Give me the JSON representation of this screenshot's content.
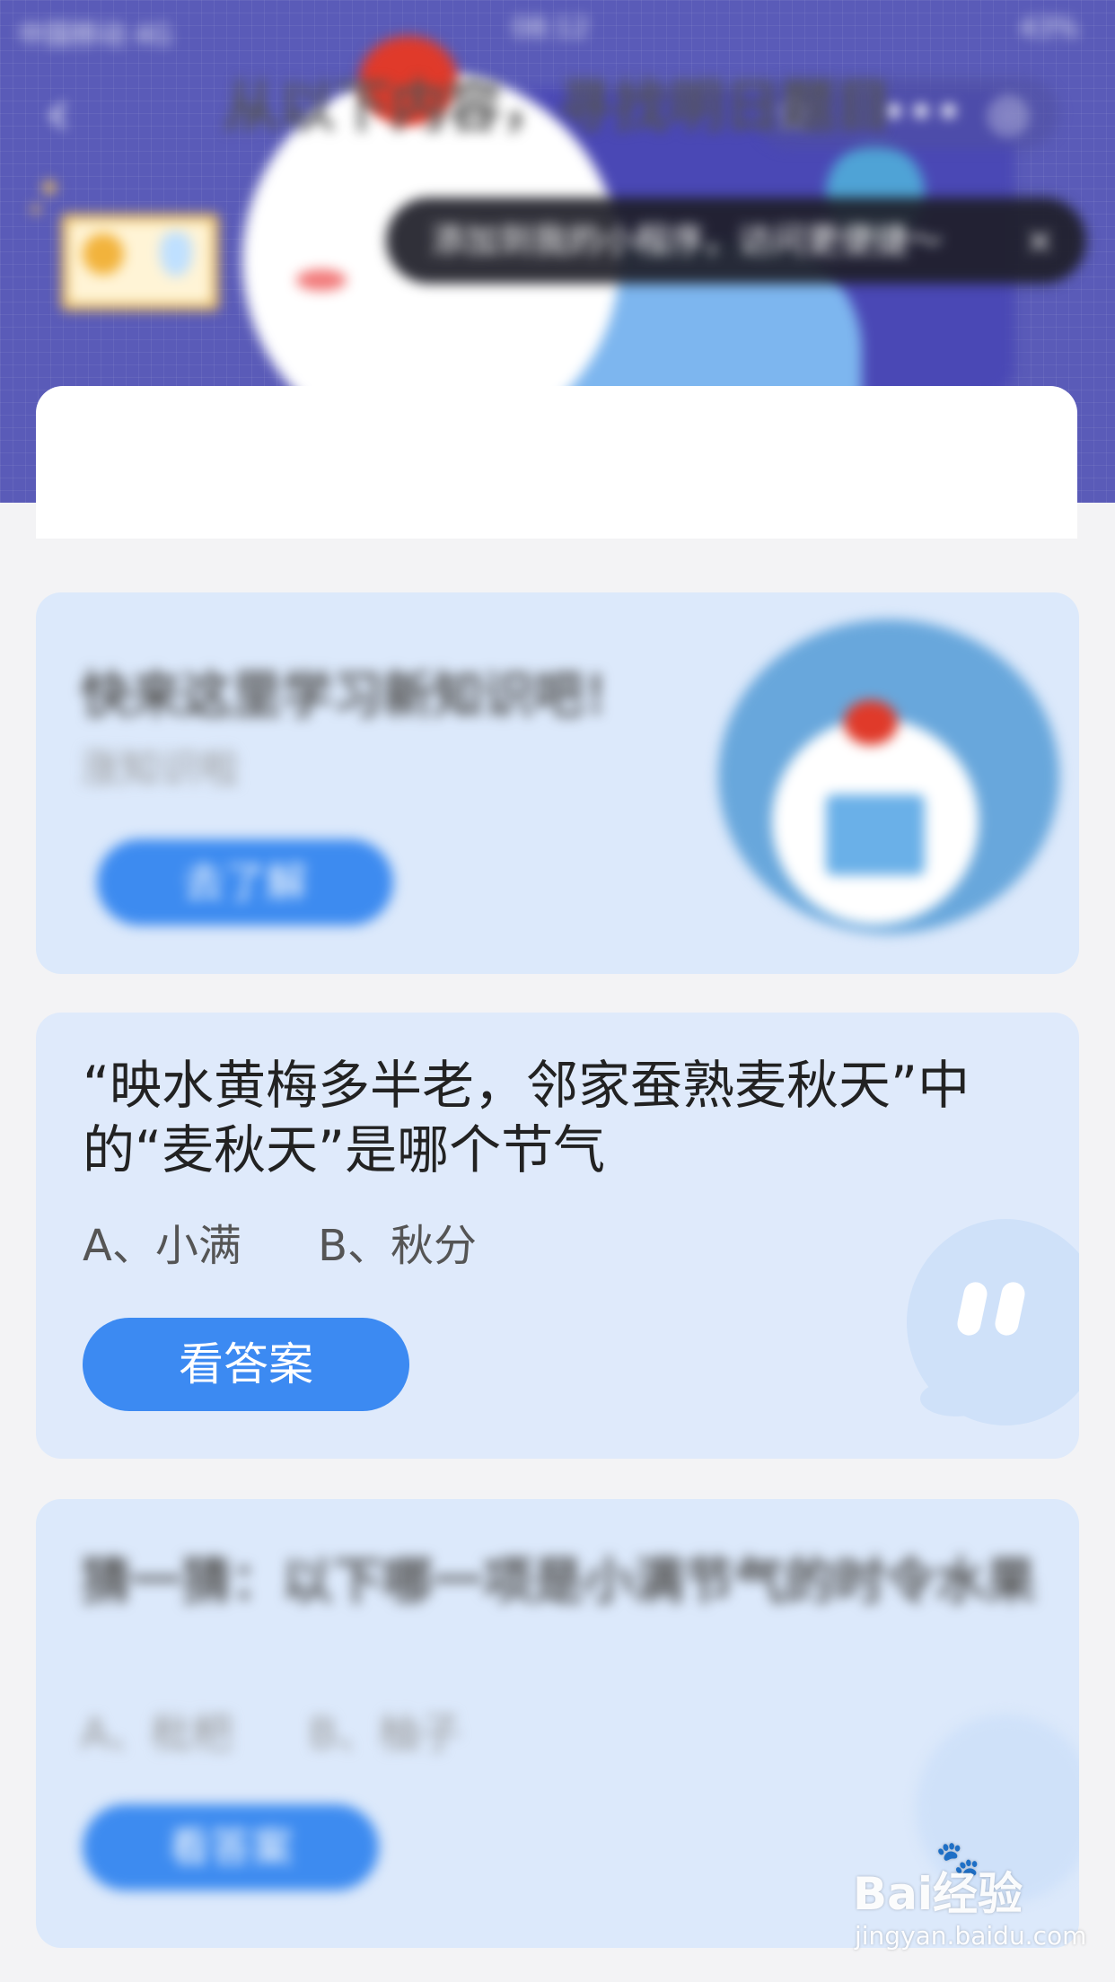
{
  "status_bar": {
    "carrier": "中国移动 4G",
    "time": "08:12",
    "battery": "43%"
  },
  "nav": {
    "back_icon": "back-arrow-icon",
    "tools": [
      "star-icon",
      "more-icon",
      "target-icon"
    ]
  },
  "tooltip": {
    "text": "添加到我的小程序，访问更便捷～",
    "close": "×"
  },
  "header": {
    "title": "从以下内容，寻找明日题目"
  },
  "card_learn": {
    "title": "快来这里学习新知识吧！",
    "subtitle": "涨知识啦",
    "button": "去了解"
  },
  "card_question": {
    "question": "“映水黄梅多半老，邻家蚕熟麦秋天”中的“麦秋天”是哪个节气",
    "options": [
      "A、小满",
      "B、秋分"
    ],
    "button": "看答案"
  },
  "card_guess": {
    "question": "猜一猜：以下哪一项是小满节气的时令水果",
    "options": [
      "A、枇杷",
      "B、柚子"
    ],
    "button": "看答案"
  },
  "watermark": {
    "logo": "Bai经验",
    "url": "jingyan.baidu.com"
  },
  "colors": {
    "primary_button": "#3c8af2",
    "card_bg": "#dfeafb",
    "header_bg": "#5a5bb8"
  }
}
